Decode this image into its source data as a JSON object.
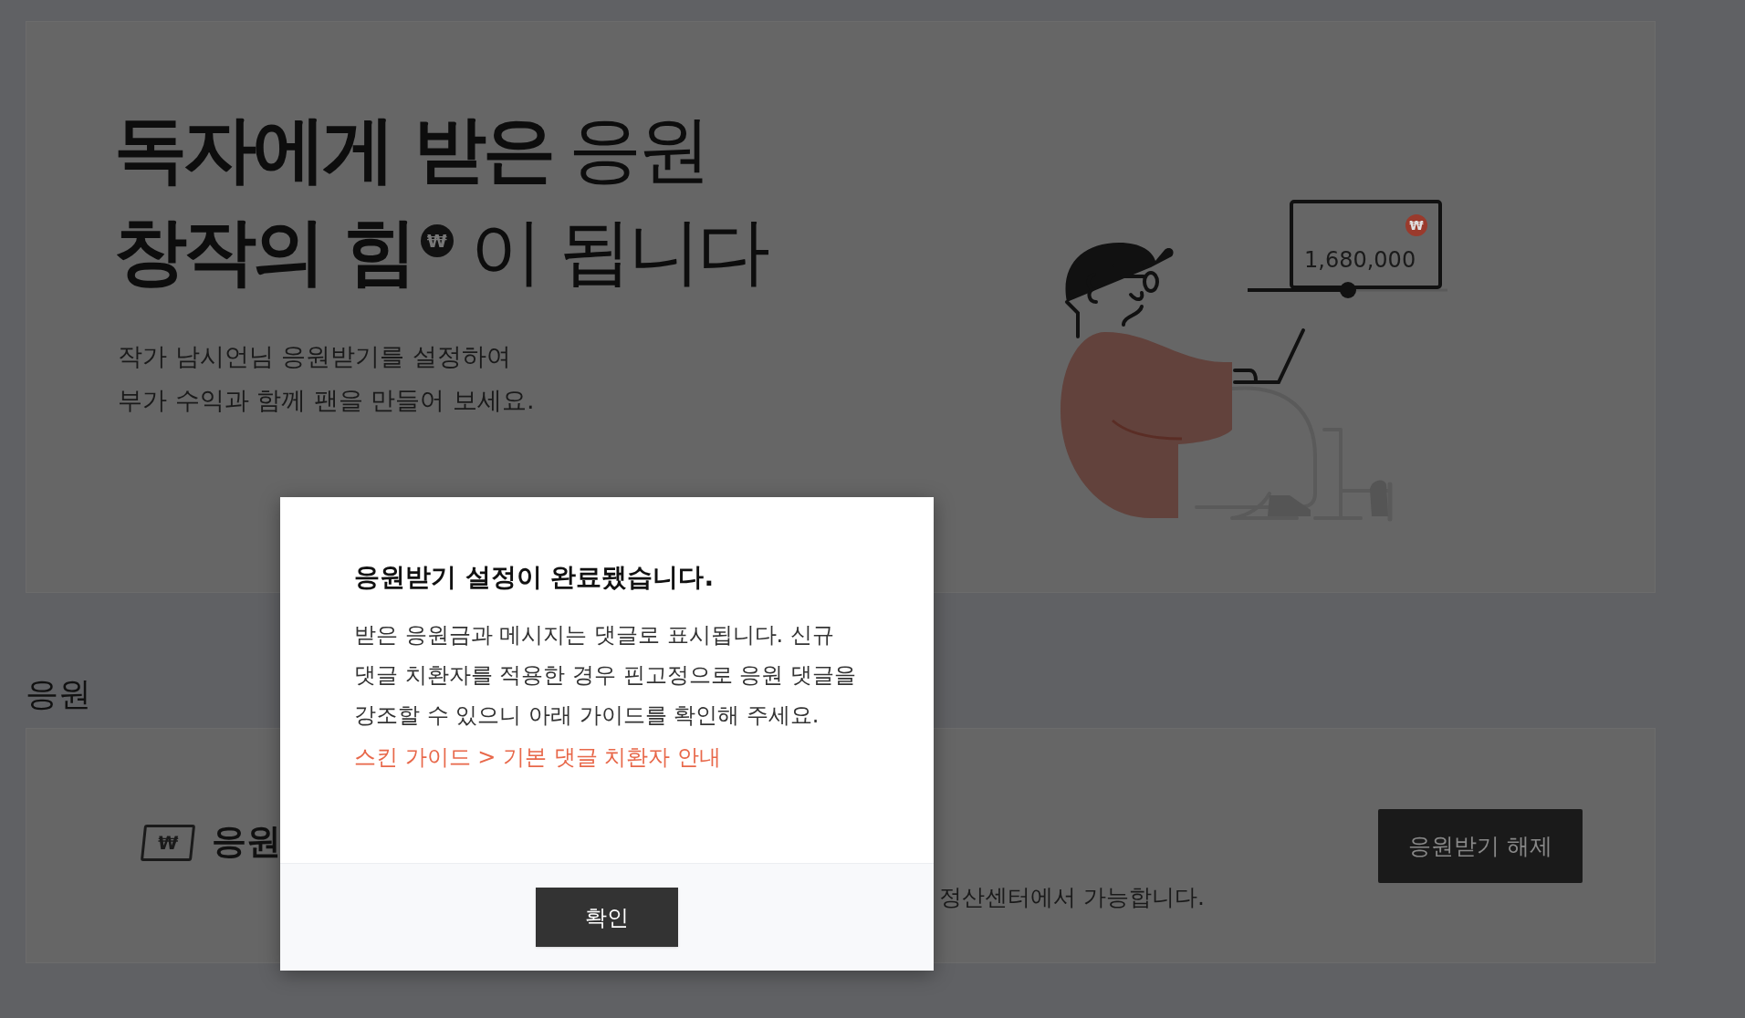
{
  "hero": {
    "title_lines": [
      [
        {
          "kind": "text",
          "text": "독자에게 받은",
          "bold": true
        },
        {
          "kind": "text",
          "text": "응원",
          "bold": false
        }
      ],
      [
        {
          "kind": "text",
          "text": "창작의 힘",
          "bold": true
        },
        {
          "kind": "badge",
          "text": "₩"
        },
        {
          "kind": "text",
          "text": "이 됩니다",
          "bold": false
        }
      ]
    ],
    "subtitle": [
      "작가 남시언님 응원받기를 설정하여",
      "부가 수익과 함께 팬을 만들어 보세요."
    ],
    "illustration": {
      "amount": "1,680,000",
      "currency": "₩"
    }
  },
  "section": {
    "heading": "응원",
    "card": {
      "icon_text": "₩",
      "title": "응원",
      "note": "정산센터에서 가능합니다.",
      "button": "응원받기 해제"
    }
  },
  "dialog": {
    "title": "응원받기 설정이 완료됐습니다.",
    "body": [
      "받은 응원금과 메시지는 댓글로 표시됩니다. 신규",
      "댓글 치환자를 적용한 경우 핀고정으로 응원 댓글을",
      "강조할 수 있으니 아래 가이드를 확인해 주세요."
    ],
    "link": "스킨 가이드 > 기본 댓글 치환자 안내",
    "confirm": "확인"
  }
}
